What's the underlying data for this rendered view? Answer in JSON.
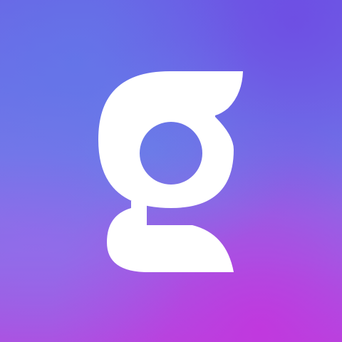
{
  "app_icon": {
    "name": "g-logo-icon",
    "background_colors": [
      "#5e79e9",
      "#703ae1",
      "#6c82e8",
      "#9669ec",
      "#c434de"
    ],
    "glyph_color": "#ffffff"
  }
}
